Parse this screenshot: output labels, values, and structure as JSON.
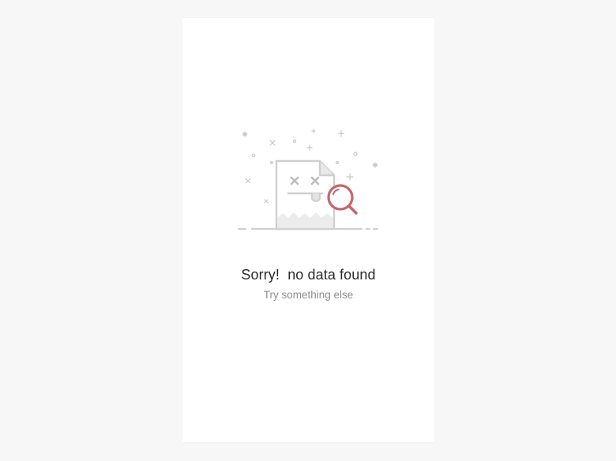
{
  "empty_state": {
    "title": "Sorry!  no data found",
    "subtitle": "Try something else",
    "illustration": "broken-document-with-magnifier-icon"
  },
  "colors": {
    "page_background": "#f7f7f7",
    "card_background": "#ffffff",
    "title": "#2a2a2a",
    "subtitle": "#8e8e8e",
    "illustration_stroke": "#cfcfcf",
    "accent": "#c9646c"
  }
}
